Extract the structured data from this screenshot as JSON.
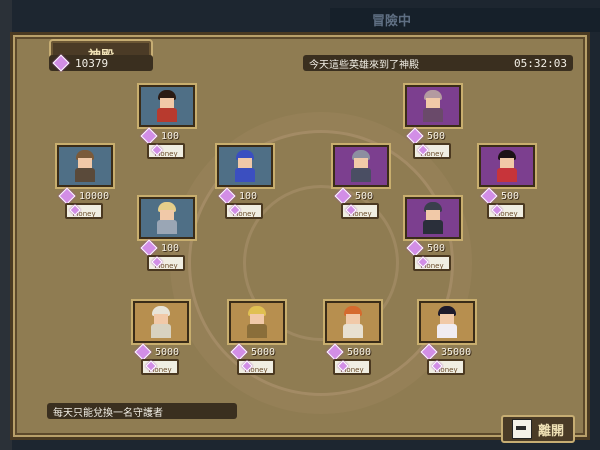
{
  "window": {
    "title": "神殿",
    "background_title": "冒險中"
  },
  "currency": {
    "gems": "10379"
  },
  "notice": {
    "text": "今天這些英雄來到了神殿",
    "timer": "05:32:03"
  },
  "heroes": [
    {
      "name": "swordsman",
      "tier": "blue",
      "price": "100",
      "button": "Money",
      "hair": "#2a1b14",
      "body": "#b83a2e"
    },
    {
      "name": "purple-beast",
      "tier": "purple",
      "price": "500",
      "button": "Money",
      "hair": "#b39aa0",
      "body": "#6a4a6a"
    },
    {
      "name": "bearded-dwarf",
      "tier": "blue",
      "price": "10000",
      "button": "Money",
      "hair": "#7a5a3a",
      "body": "#5a4a3a"
    },
    {
      "name": "blue-haired-mage",
      "tier": "blue",
      "price": "100",
      "button": "Money",
      "hair": "#3b4fc0",
      "body": "#3b4fc0"
    },
    {
      "name": "dark-knight",
      "tier": "purple",
      "price": "500",
      "button": "Money",
      "hair": "#8c8fa0",
      "body": "#4a4e63"
    },
    {
      "name": "red-dancer",
      "tier": "purple",
      "price": "500",
      "button": "Money",
      "hair": "#1c1216",
      "body": "#c7343a"
    },
    {
      "name": "blonde-knight",
      "tier": "blue",
      "price": "100",
      "button": "Money",
      "hair": "#e6cf8a",
      "body": "#9aa6b5"
    },
    {
      "name": "armored-golem",
      "tier": "purple",
      "price": "500",
      "button": "Money",
      "hair": "#3a3f4c",
      "body": "#2a2f3a"
    },
    {
      "name": "white-paladin",
      "tier": "gold",
      "price": "5000",
      "button": "Money",
      "hair": "#e8e4d8",
      "body": "#d8d2c0"
    },
    {
      "name": "golden-warrior",
      "tier": "gold",
      "price": "5000",
      "button": "Money",
      "hair": "#e0c052",
      "body": "#8a6e3a"
    },
    {
      "name": "red-haired-girl",
      "tier": "gold",
      "price": "5000",
      "button": "Money",
      "hair": "#d56a2e",
      "body": "#e8e0d0"
    },
    {
      "name": "dark-haired-priestess",
      "tier": "gold",
      "price": "35000",
      "button": "Money",
      "hair": "#1e1a2a",
      "body": "#f0ecf2"
    }
  ],
  "footer": {
    "note": "每天只能兌換一名守護者",
    "leave": "離開",
    "exit_icon_text": "EXIT"
  }
}
